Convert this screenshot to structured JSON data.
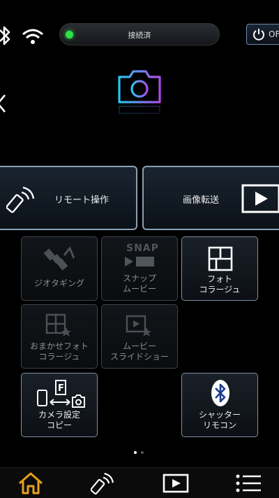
{
  "status": {
    "connection_label": "接続済",
    "power_label": "OF"
  },
  "mode_icon": "camera-icon",
  "main_buttons": [
    {
      "label": "リモート操作",
      "icon": "remote-icon"
    },
    {
      "label": "画像転送",
      "icon": "play-icon"
    }
  ],
  "tiles": [
    {
      "label": "ジオタギング",
      "icon": "satellite-icon",
      "enabled": false
    },
    {
      "label": "スナップ\nムービー",
      "icon": "snap-movie-icon",
      "badge": "SNAP",
      "enabled": false
    },
    {
      "label": "フォト\nコラージュ",
      "icon": "photo-collage-icon",
      "enabled": true
    },
    {
      "label": "おまかせフォト\nコラージュ",
      "icon": "auto-collage-icon",
      "enabled": false
    },
    {
      "label": "ムービー\nスライドショー",
      "icon": "slideshow-icon",
      "enabled": false
    },
    {
      "label": "カメラ設定\nコピー",
      "icon": "settings-copy-icon",
      "enabled": true
    },
    {
      "label": "シャッター\nリモコン",
      "icon": "bluetooth-icon",
      "enabled": true
    }
  ],
  "pager": {
    "current": 1,
    "total": 2
  },
  "bottom_nav": [
    "home-icon",
    "remote-icon",
    "play-icon",
    "menu-icon"
  ],
  "colors": {
    "accent_nav": "#e5a019",
    "connected": "#2fe04a"
  }
}
